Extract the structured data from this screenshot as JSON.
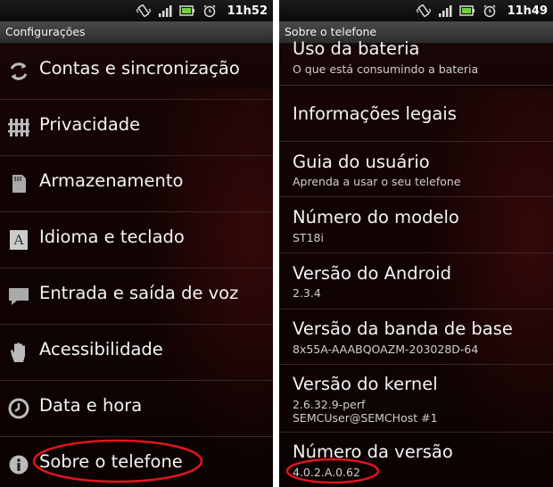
{
  "left": {
    "status_time": "11h52",
    "title": "Configurações",
    "items": [
      {
        "label": "Contas e sincronização",
        "icon": "sync-icon"
      },
      {
        "label": "Privacidade",
        "icon": "privacy-icon"
      },
      {
        "label": "Armazenamento",
        "icon": "storage-icon"
      },
      {
        "label": "Idioma e teclado",
        "icon": "language-icon"
      },
      {
        "label": "Entrada e saída de voz",
        "icon": "speech-icon"
      },
      {
        "label": "Acessibilidade",
        "icon": "hand-icon"
      },
      {
        "label": "Data e hora",
        "icon": "clock-icon"
      },
      {
        "label": "Sobre o telefone",
        "icon": "info-icon"
      }
    ]
  },
  "right": {
    "status_time": "11h49",
    "title": "Sobre o telefone",
    "battery": {
      "title": "Uso da bateria",
      "subtitle": "O que está consumindo a bateria"
    },
    "legal": {
      "title": "Informações legais"
    },
    "guide": {
      "title": "Guia do usuário",
      "subtitle": "Aprenda a usar o seu telefone"
    },
    "model": {
      "title": "Número do modelo",
      "value": "ST18i"
    },
    "android": {
      "title": "Versão do Android",
      "value": "2.3.4"
    },
    "baseband": {
      "title": "Versão da banda de base",
      "value": "8x55A-AAABQOAZM-203028D-64"
    },
    "kernel": {
      "title": "Versão do kernel",
      "value_line1": "2.6.32.9-perf",
      "value_line2": "SEMCUser@SEMCHost #1"
    },
    "build": {
      "title": "Número da versão",
      "value": "4.0.2.A.0.62"
    }
  },
  "colors": {
    "highlight_ellipse": "#e0141e",
    "background": "#120303",
    "text": "#f4f4f4"
  }
}
